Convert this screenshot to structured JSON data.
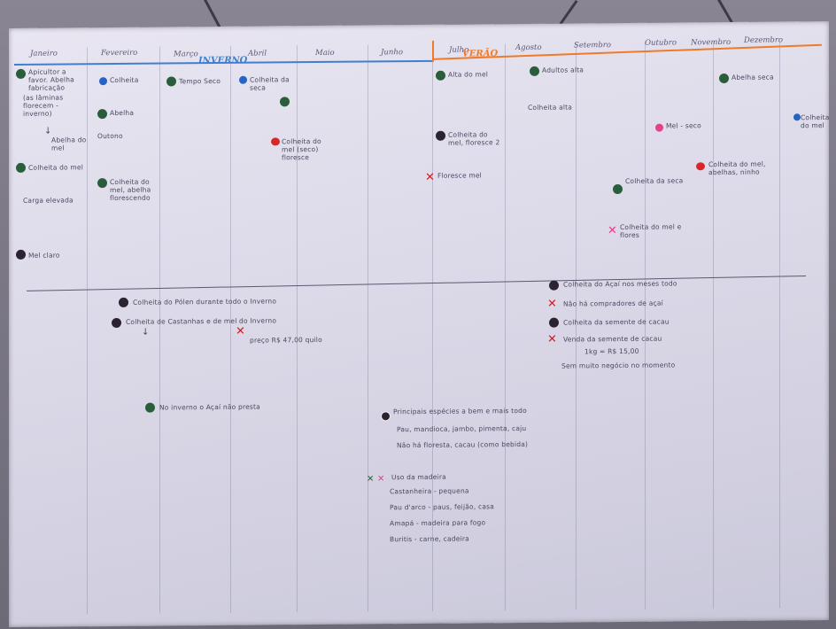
{
  "colors": {
    "paper": "#dedbea",
    "blue_line": "#3f7fd0",
    "orange_line": "#f07a2a",
    "dot_green": "#2a5e3b",
    "dot_black": "#2b2430",
    "dot_blue": "#2563c6",
    "dot_red": "#d8262a",
    "dot_pink": "#e0428c",
    "mark_red": "#c8202a",
    "ink": "#4a4660"
  },
  "months": [
    "Janeiro",
    "Fevereiro",
    "Março",
    "Abril",
    "Maio",
    "Junho",
    "Julho",
    "Agosto",
    "Setembro",
    "Outubro",
    "Novembro",
    "Dezembro"
  ],
  "phases": {
    "left": "INVERNO",
    "right": "VERÃO"
  },
  "notes_top": [
    "Apicultor a favor. Abelha fabricação",
    "(as lâminas florecem - inverno)",
    "Abelha do mel",
    "Colheita do mel",
    "Carga elevada",
    "Mel claro",
    "Colheita",
    "Abelha",
    "Outono",
    "Colheita do mel, abelha florescendo",
    "Tempo Seco",
    "Colheita da seca",
    "Colheita do mel (seco) floresce",
    "Alta do mel",
    "Colheita do mel, floresce 2",
    "Floresce mel",
    "Adultos alta",
    "Colheita alta",
    "Mel - seco",
    "Colheita do mel, abelhas, ninho",
    "Colheita da seca",
    "Colheita do mel e flores",
    "Abelha seca",
    "Colheita do mel"
  ],
  "notes_bottom": [
    "Colheita do Pólen durante todo o Inverno",
    "Colheita de Castanhas e de mel do Inverno",
    "preço R$ 47,00 quilo",
    "Colheita do Açaí nos meses todo",
    "Não há compradores de açaí",
    "Colheita da semente de cacau",
    "Venda da semente de cacau",
    "1kg = R$ 15,00",
    "Sem muito negócio no momento",
    "No inverno o Açaí não presta",
    "Principais espécies a bem e mais todo",
    "Pau, mandioca, jambo, pimenta, caju",
    "Não há floresta, cacau (como bebida)",
    "Uso da madeira",
    "Castanheira - pequena",
    "Pau d'arco - paus, feijão, casa",
    "Amapá - madeira para fogo",
    "Buritis - carne, cadeira"
  ]
}
